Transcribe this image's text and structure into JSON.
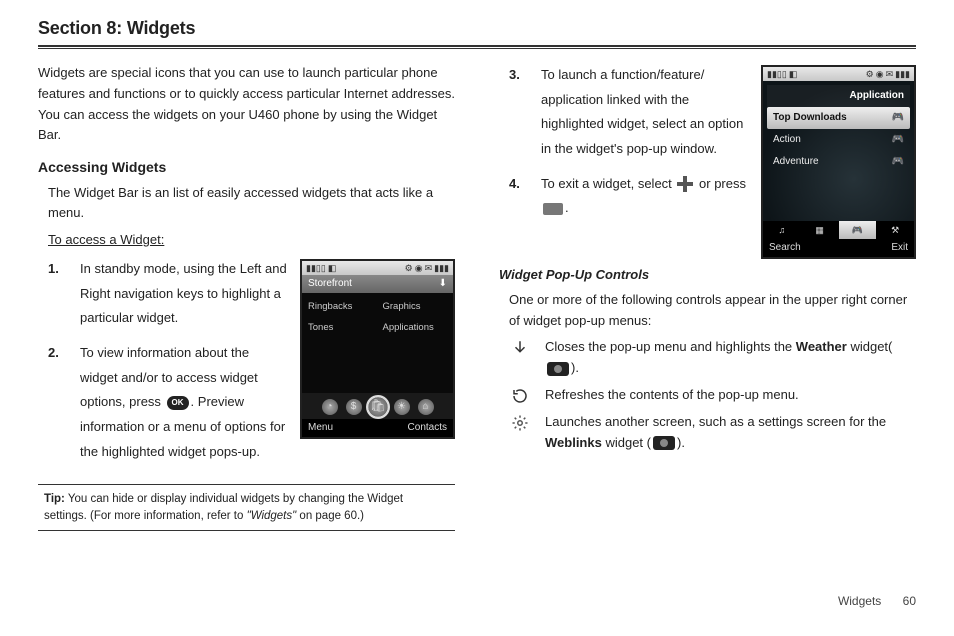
{
  "section_title": "Section 8: Widgets",
  "left": {
    "intro": "Widgets are special icons that you can use to launch particular phone features and functions or to quickly access particular Internet addresses. You can access the widgets on your U460 phone by using the Widget Bar.",
    "sub_accessing": "Accessing Widgets",
    "accessing_body": "The Widget Bar is an list of easily accessed widgets that acts like a menu.",
    "to_access": "To access a Widget:",
    "step1": "In standby mode, using the Left and Right navigation keys to highlight a particular widget.",
    "step2_a": "To view information about the widget and/or to access widget options, press ",
    "step2_b": ". Preview information or a menu of options for the highlighted widget pops-up.",
    "tip_label": "Tip:",
    "tip_text_a": "You can hide or display individual widgets by changing the Widget settings. (For more information, refer to ",
    "tip_ref": "\"Widgets\"",
    "tip_text_b": " on page 60.)"
  },
  "right": {
    "step3": "To launch a function/feature/ application linked with the highlighted widget, select an option in the widget's pop-up window.",
    "step4_a": "To exit a widget, select ",
    "step4_b": " or press ",
    "step4_c": ".",
    "popup_head": "Widget Pop-Up Controls",
    "popup_body": "One or more of the following controls appear in the upper right corner of widget pop-up menus:",
    "ctrl1_a": "Closes the pop-up menu and highlights the ",
    "ctrl1_bold": "Weather",
    "ctrl1_b": " widget(",
    "ctrl1_c": ").",
    "ctrl2": "Refreshes the contents of the pop-up menu.",
    "ctrl3_a": "Launches another screen, such as a settings screen for the ",
    "ctrl3_bold": "Weblinks",
    "ctrl3_b": " widget (",
    "ctrl3_c": ")."
  },
  "phone1": {
    "header": "Storefront",
    "items": [
      "Ringbacks",
      "Graphics",
      "Tones",
      "Applications"
    ],
    "sk_left": "Menu",
    "sk_right": "Contacts"
  },
  "phone2": {
    "cat_header": "Application",
    "rows": [
      "Top Downloads",
      "Action",
      "Adventure"
    ],
    "sk_left": "Search",
    "sk_right": "Exit"
  },
  "footer": {
    "label": "Widgets",
    "page": "60"
  }
}
